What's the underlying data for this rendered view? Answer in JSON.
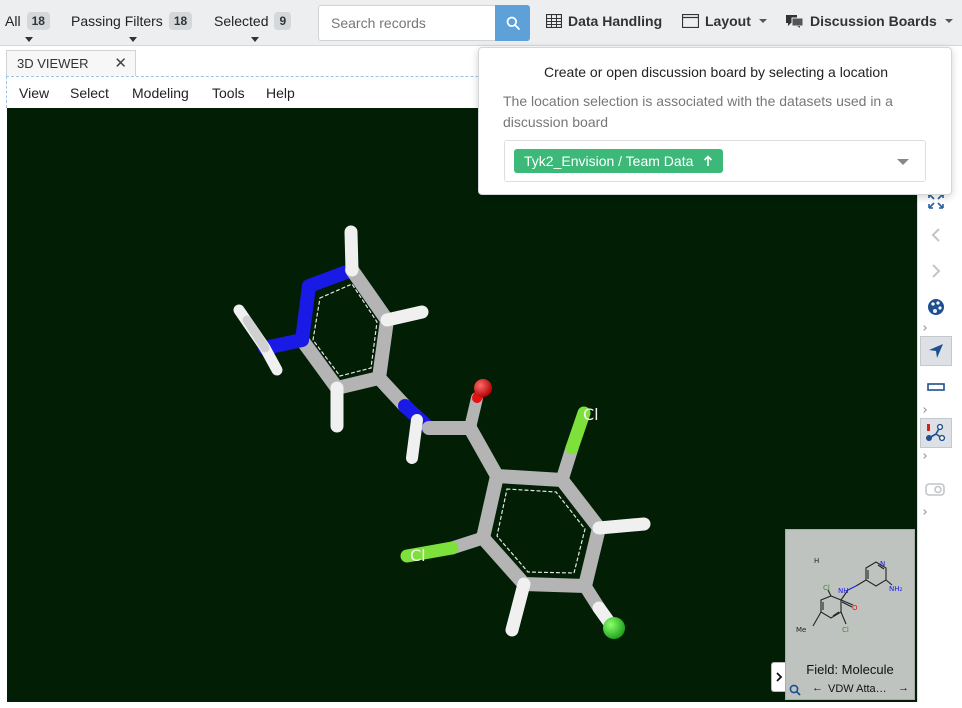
{
  "toolbar": {
    "filters": [
      {
        "label": "All",
        "count": "18"
      },
      {
        "label": "Passing Filters",
        "count": "18"
      },
      {
        "label": "Selected",
        "count": "9"
      }
    ],
    "search": {
      "placeholder": "Search records",
      "value": ""
    },
    "menus": [
      {
        "label": "Data Handling",
        "icon": "table-icon"
      },
      {
        "label": "Layout",
        "icon": "window-icon"
      },
      {
        "label": "Discussion Boards",
        "icon": "chat-icon"
      }
    ]
  },
  "tab": {
    "label": "3D VIEWER",
    "close": "✕"
  },
  "menubar": {
    "items": [
      "View",
      "Select",
      "Modeling",
      "Tools",
      "Help"
    ]
  },
  "viewer": {
    "atom_labels": [
      "Cl",
      "Cl"
    ],
    "colors": {
      "background": "#021f06",
      "carbon": "#b4b4b4",
      "nitrogen": "#1a1ae6",
      "oxygen": "#e61010",
      "chlorine": "#7ee03a",
      "hydrogen": "#f0f0f0"
    }
  },
  "thumbnail": {
    "field_label": "Field: Molecule",
    "property": "VDW Atta…",
    "atoms": {
      "h": "H",
      "cl_top": "Cl",
      "cl_bottom": "Cl",
      "nh": "NH",
      "nh2": "NH₂",
      "me": "Me",
      "n": "N",
      "o": "O"
    }
  },
  "popover": {
    "title": "Create or open discussion board by selecting a location",
    "description": "The location selection is associated with the datasets used in a discussion board",
    "selected": "Tyk2_Envision / Team Data",
    "accent": "#3cb878"
  }
}
